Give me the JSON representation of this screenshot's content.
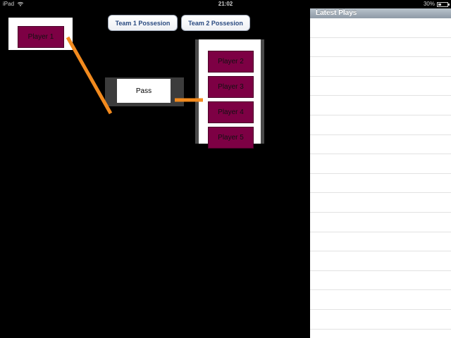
{
  "status_bar": {
    "device": "iPad",
    "time": "21:02",
    "battery": "30%",
    "battery_level": 0.3
  },
  "team_buttons": [
    {
      "label": "Team 1 Possesion"
    },
    {
      "label": "Team 2 Possesion"
    }
  ],
  "source_player": {
    "label": "Player 1"
  },
  "action": {
    "label": "Pass"
  },
  "target_players": [
    {
      "label": "Player 2"
    },
    {
      "label": "Player 3"
    },
    {
      "label": "Player 4"
    },
    {
      "label": "Player 5"
    }
  ],
  "latest_plays": {
    "title": "Latest Plays",
    "rows": [
      "",
      "",
      "",
      "",
      "",
      "",
      "",
      "",
      "",
      "",
      "",
      "",
      "",
      "",
      "",
      "",
      ""
    ]
  },
  "colors": {
    "player_tile": "#7d0044",
    "connector": "#f28a1e",
    "panel_header": "#8e9aa6"
  }
}
